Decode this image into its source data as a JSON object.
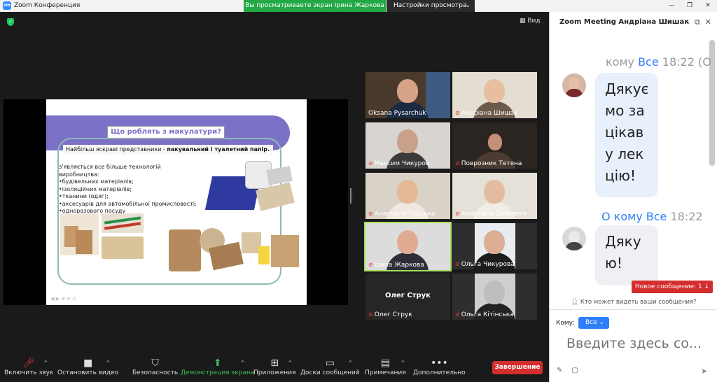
{
  "window": {
    "title": "Zoom Конференция",
    "logo_text": "zm",
    "banner": "Вы просматриваете экран Ірина Жаркова",
    "view_settings": "Настройки просмотра",
    "view_button": "Вид"
  },
  "slide": {
    "title": "Що роблять з макулатури?",
    "subtitle_prefix": "Найбільш яскраві представники - ",
    "subtitle_bold": "пакувальний і туалетний папір.",
    "list": [
      "з'являється все більше технологій виробництва:",
      "•будівельних матеріалів;",
      "•ізоляційних матеріалів;",
      "•тканини (одяг);",
      "•аксесуарів для автомобільної промисловості;",
      "•одноразового посуду"
    ]
  },
  "participants": [
    {
      "name": "Oksana Pysarchuk",
      "muted": false,
      "big_text": ""
    },
    {
      "name": "Андріана Шишак",
      "muted": true,
      "big_text": ""
    },
    {
      "name": "Максим Чикуров",
      "muted": true,
      "big_text": ""
    },
    {
      "name": "Поврозник Тетяна",
      "muted": true,
      "big_text": ""
    },
    {
      "name": "Анастасія Гурська",
      "muted": true,
      "big_text": ""
    },
    {
      "name": "Анастасія Зачкевич",
      "muted": true,
      "big_text": ""
    },
    {
      "name": "Ірина Жаркова",
      "muted": true,
      "big_text": ""
    },
    {
      "name": "Ольга Чикурова",
      "muted": true,
      "big_text": ""
    },
    {
      "name": "Олег Струк",
      "muted": true,
      "big_text": "Олег Струк"
    },
    {
      "name": "Ольга Кітінська",
      "muted": true,
      "big_text": ""
    }
  ],
  "toolbar": {
    "unmute": "Включить звук",
    "stop_video": "Остановить видео",
    "security": "Безопасность",
    "share": "Демонстрация экрана",
    "apps": "Приложения",
    "whiteboards": "Доски сообщений",
    "notes": "Примечания",
    "more": "Дополнительно",
    "end": "Завершение"
  },
  "chat": {
    "title": "Zoom Meeting Андріана Шишак",
    "msg1_meta_prefix": "кому ",
    "msg1_meta_to": "Все",
    "msg1_meta_time": " 18:22 (О",
    "msg1_lines": [
      "Дякує",
      "мо за",
      "цікав",
      "у лек",
      "цію!"
    ],
    "msg2_meta_prefix": "О кому ",
    "msg2_meta_to": "Все",
    "msg2_meta_time": " 18:22",
    "msg2_lines": [
      "Дяку",
      "ю!"
    ],
    "new_message": "Новое сообщение: 1 ↓",
    "who_can_see": "Кто может видеть ваши сообщения?",
    "to_label": "Кому:",
    "to_value": "Все",
    "input_placeholder": "Введите здесь со..."
  }
}
